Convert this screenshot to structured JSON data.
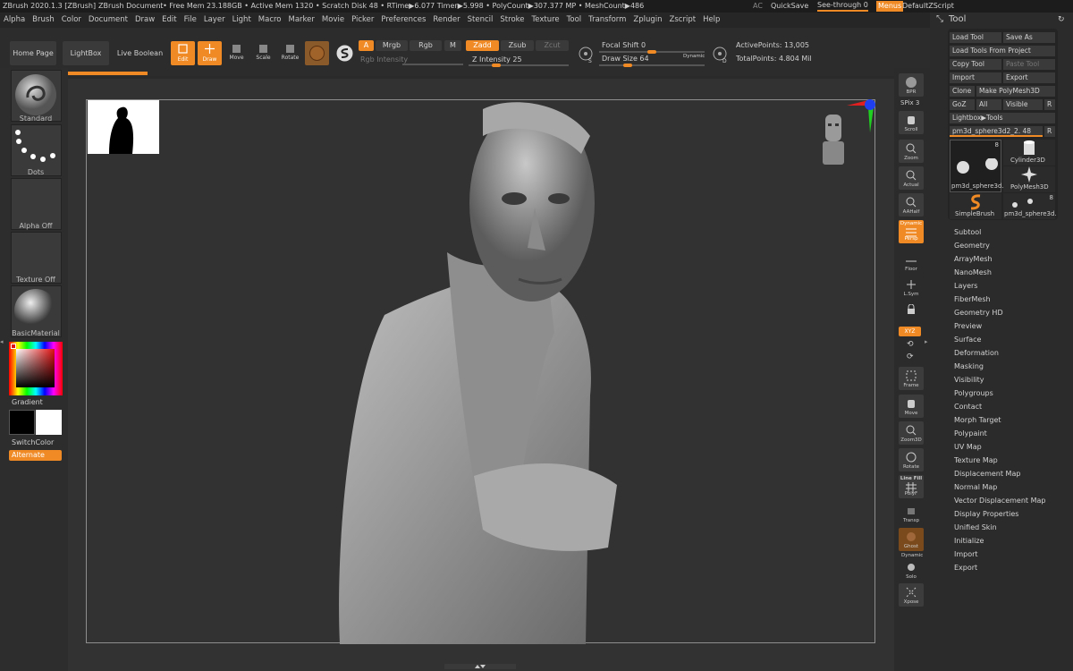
{
  "titlebar": {
    "app_title": "ZBrush 2020.1.3 [ZBrush]",
    "document": "ZBrush Document",
    "stats": "..• Free Mem 23.188GB • Active Mem 1320 • Scratch Disk 48 • RTime▶6.077 Timer▶5.998 • PolyCount▶307.377 MP • MeshCount▶486",
    "ac": "AC",
    "quicksave": "QuickSave",
    "see_through": "See-through 0",
    "menus": "Menus",
    "zscript": "DefaultZScript"
  },
  "menubar": [
    "Alpha",
    "Brush",
    "Color",
    "Document",
    "Draw",
    "Edit",
    "File",
    "Layer",
    "Light",
    "Macro",
    "Marker",
    "Movie",
    "Picker",
    "Preferences",
    "Render",
    "Stencil",
    "Stroke",
    "Texture",
    "Tool",
    "Transform",
    "Zplugin",
    "Zscript",
    "Help"
  ],
  "shelf": {
    "home": "Home Page",
    "lightbox": "LightBox",
    "live_boolean": "Live Boolean",
    "edit": "Edit",
    "draw": "Draw",
    "move": "Move",
    "scale": "Scale",
    "rotate": "Rotate",
    "a": "A",
    "mrgb": "Mrgb",
    "rgb": "Rgb",
    "m": "M",
    "rgb_intensity": "Rgb Intensity",
    "zadd": "Zadd",
    "zsub": "Zsub",
    "zcut": "Zcut",
    "z_intensity": "Z Intensity 25",
    "z_intensity_value": 25,
    "focal_shift": "Focal Shift 0",
    "draw_size": "Draw Size 64",
    "draw_size_value": 64,
    "dynamic": "Dynamic",
    "s_key": "S",
    "d_key": "D",
    "active_points": "ActivePoints: 13,005",
    "total_points": "TotalPoints: 4.804 Mil"
  },
  "left_tray": {
    "brush": "Standard",
    "stroke": "Dots",
    "alpha": "Alpha Off",
    "texture": "Texture Off",
    "material": "BasicMaterial",
    "gradient": "Gradient",
    "switchcolor": "SwitchColor",
    "alternate": "Alternate"
  },
  "right_tray": {
    "bpr": "BPR",
    "spix": "SPix 3",
    "scroll": "Scroll",
    "zoom": "Zoom",
    "actual": "Actual",
    "aahalf": "AAHalf",
    "dynamic": "Dynamic",
    "persp": "Persp",
    "floor": "Floor",
    "lsym": "L.Sym",
    "xyz": "XYZ",
    "frame": "Frame",
    "move": "Move",
    "zoom3d": "Zoom3D",
    "rotate": "Rotate",
    "line_fill": "Line Fill",
    "polyf": "PolyF",
    "transp": "Transp",
    "ghost": "Ghost",
    "dynamic2": "Dynamic",
    "solo": "Solo",
    "xpose": "Xpose"
  },
  "tool_panel": {
    "title": "Tool",
    "load_tool": "Load Tool",
    "save_as": "Save As",
    "load_from_project": "Load Tools From Project",
    "copy_tool": "Copy Tool",
    "paste_tool": "Paste Tool",
    "import": "Import",
    "export": "Export",
    "clone": "Clone",
    "make_polymesh": "Make PolyMesh3D",
    "goz": "GoZ",
    "all": "All",
    "visible": "Visible",
    "r": "R",
    "lightbox_tools": "Lightbox▶Tools",
    "current_tool": "pm3d_sphere3d2_2. 48",
    "r2": "R",
    "thumbs": [
      {
        "label": "pm3d_sphere3d.",
        "count": "8"
      },
      {
        "label": "Cylinder3D",
        "count": ""
      },
      {
        "label": "PolyMesh3D",
        "count": ""
      },
      {
        "label": "SimpleBrush",
        "count": ""
      },
      {
        "label": "pm3d_sphere3d.",
        "count": "8"
      }
    ],
    "subpalettes": [
      "Subtool",
      "Geometry",
      "ArrayMesh",
      "NanoMesh",
      "Layers",
      "FiberMesh",
      "Geometry HD",
      "Preview",
      "Surface",
      "Deformation",
      "Masking",
      "Visibility",
      "Polygroups",
      "Contact",
      "Morph Target",
      "Polypaint",
      "UV Map",
      "Texture Map",
      "Displacement Map",
      "Normal Map",
      "Vector Displacement Map",
      "Display Properties",
      "Unified Skin",
      "Initialize",
      "Import",
      "Export"
    ]
  },
  "colors": {
    "accent": "#f08a24",
    "background": "#2a2a2a",
    "viewport": "#323232"
  }
}
